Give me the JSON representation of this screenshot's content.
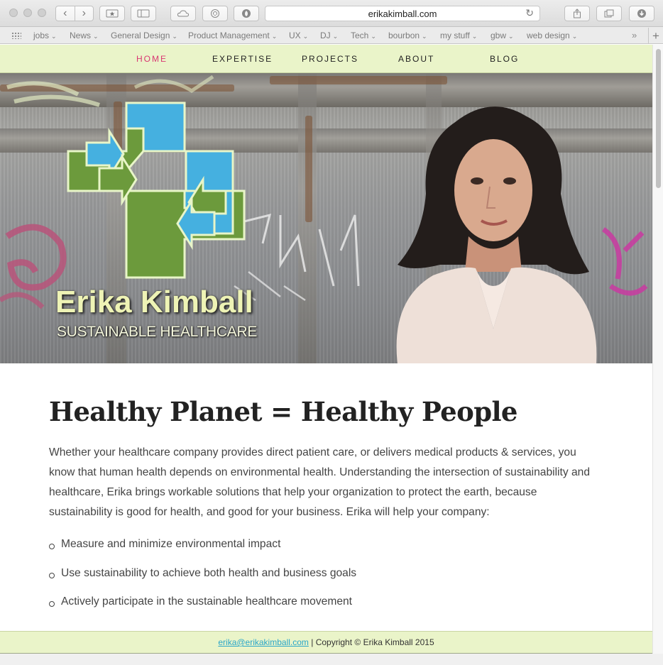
{
  "browser": {
    "url": "erikakimball.com",
    "bookmarks": [
      "jobs",
      "News",
      "General Design",
      "Product Management",
      "UX",
      "DJ",
      "Tech",
      "bourbon",
      "my stuff",
      "gbw",
      "web design"
    ],
    "icons": [
      "back-icon",
      "forward-icon",
      "bookmarks-star-icon",
      "sidebar-icon",
      "icloud-icon",
      "sync-icon",
      "privacy-icon",
      "reload-icon",
      "share-icon",
      "tabs-icon",
      "downloads-icon",
      "new-tab-icon",
      "overflow-icon"
    ]
  },
  "nav": {
    "items": [
      {
        "label": "HOME",
        "active": true
      },
      {
        "label": "EXPERTISE",
        "active": false
      },
      {
        "label": "PROJECTS",
        "active": false
      },
      {
        "label": "ABOUT",
        "active": false
      },
      {
        "label": "BLOG",
        "active": false
      }
    ],
    "active_color": "#d93772",
    "background": "#eaf4c9"
  },
  "hero": {
    "name": "Erika Kimball",
    "tagline": "SUSTAINABLE HEALTHCARE",
    "logo_colors": {
      "blue": "#45b0e0",
      "green": "#6c9a3c",
      "outline": "#e8f5c8"
    }
  },
  "main": {
    "headline": "Healthy Planet = Healthy People",
    "intro": "Whether your healthcare company provides direct patient care, or delivers medical products & services, you know that human health depends on environmental health. Understanding the intersection of sustainability and healthcare, Erika brings workable solutions that help your organization to protect the earth, because sustainability is good for health, and good for your business. Erika will help your company:",
    "bullets": [
      "Measure and minimize environmental impact",
      "Use sustainability to achieve both health and business goals",
      "Actively participate in the sustainable healthcare movement"
    ]
  },
  "footer": {
    "email": "erika@erikakimball.com",
    "copyright": "| Copyright © Erika Kimball 2015"
  }
}
